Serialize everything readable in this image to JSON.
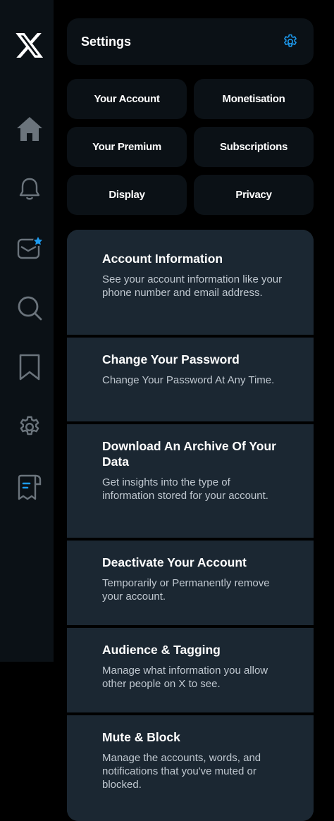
{
  "sidebar": {
    "logo_icon": "x-logo-icon",
    "items": [
      {
        "name": "home",
        "icon": "home-icon"
      },
      {
        "name": "notifications",
        "icon": "bell-icon"
      },
      {
        "name": "messages",
        "icon": "mail-icon"
      },
      {
        "name": "search",
        "icon": "search-icon"
      },
      {
        "name": "bookmarks",
        "icon": "bookmark-icon"
      },
      {
        "name": "settings",
        "icon": "gear-icon"
      },
      {
        "name": "premium",
        "icon": "receipt-icon"
      }
    ]
  },
  "header": {
    "title": "Settings",
    "icon": "gear-icon",
    "accent": "#1d9bf0"
  },
  "quick_links": [
    {
      "label": "Your Account"
    },
    {
      "label": "Monetisation"
    },
    {
      "label": "Your Premium"
    },
    {
      "label": "Subscriptions"
    },
    {
      "label": "Display"
    },
    {
      "label": "Privacy"
    }
  ],
  "settings_list": [
    {
      "title": "Account Information",
      "description": "See your account information like your phone number and email address."
    },
    {
      "title": "Change Your Password",
      "description": "Change Your Password At Any Time."
    },
    {
      "title": "Download An Archive Of Your Data",
      "description": "Get insights into the type of information stored for your account."
    },
    {
      "title": "Deactivate Your Account",
      "description": "Temporarily or Permanently remove your account."
    },
    {
      "title": "Audience & Tagging",
      "description": "Manage what information you allow other people on X to see."
    },
    {
      "title": "Mute & Block",
      "description": "Manage the accounts, words, and notifications that you've muted or blocked."
    }
  ],
  "colors": {
    "background": "#000000",
    "panel": "#0b1116",
    "list_bg": "#1b2732",
    "text": "#ffffff",
    "muted": "#c0c8d0",
    "accent": "#1d9bf0"
  }
}
